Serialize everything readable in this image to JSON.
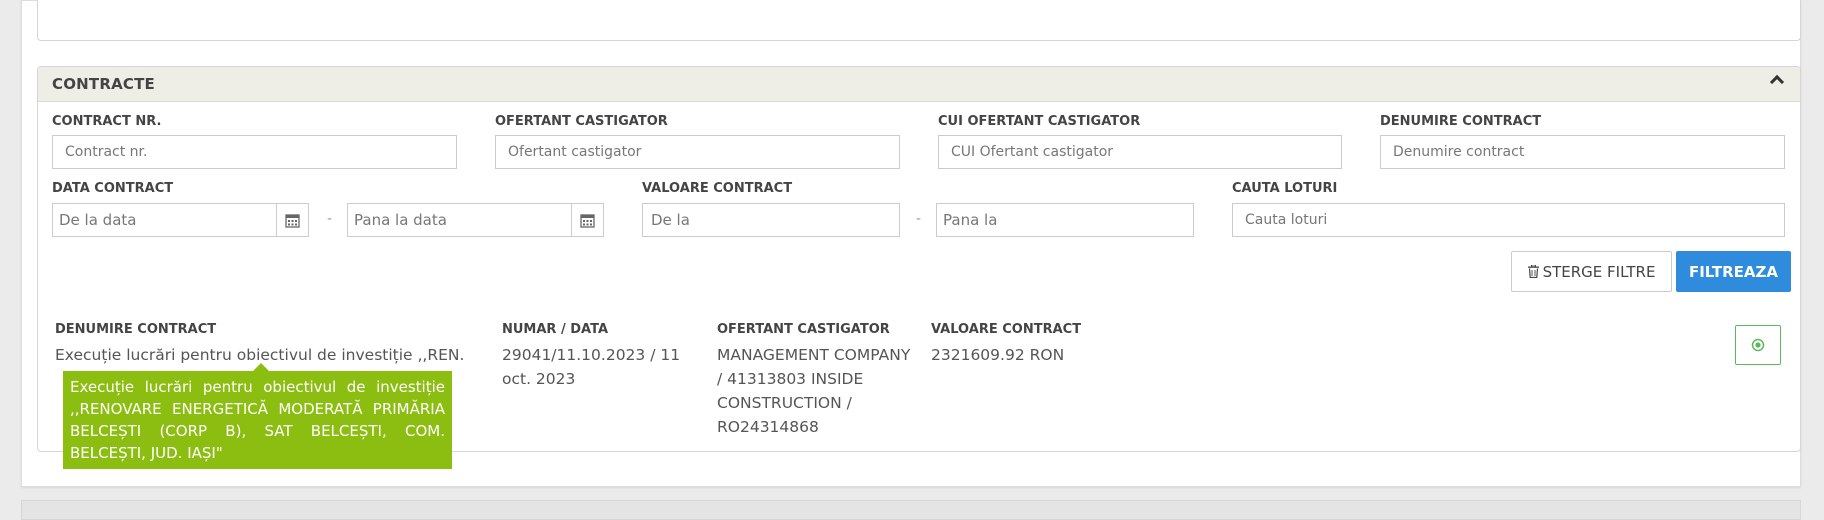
{
  "section": {
    "title": "CONTRACTE"
  },
  "filters": {
    "contract_nr": {
      "label": "CONTRACT NR.",
      "placeholder": "Contract nr."
    },
    "ofertant": {
      "label": "OFERTANT CASTIGATOR",
      "placeholder": "Ofertant castigator"
    },
    "cui": {
      "label": "CUI OFERTANT CASTIGATOR",
      "placeholder": "CUI Ofertant castigator"
    },
    "denumire": {
      "label": "DENUMIRE CONTRACT",
      "placeholder": "Denumire contract"
    },
    "data": {
      "label": "DATA CONTRACT",
      "from_placeholder": "De la data",
      "to_placeholder": "Pana la data",
      "separator": "-"
    },
    "valoare": {
      "label": "VALOARE CONTRACT",
      "from_placeholder": "De la",
      "to_placeholder": "Pana la",
      "separator": "-"
    },
    "loturi": {
      "label": "CAUTA LOTURI",
      "placeholder": "Cauta loturi"
    }
  },
  "buttons": {
    "clear_label": "STERGE FILTRE",
    "filter_label": "FILTREAZA"
  },
  "results": {
    "headers": {
      "denumire": "DENUMIRE CONTRACT",
      "numar_data": "NUMAR / DATA",
      "ofertant": "OFERTANT CASTIGATOR",
      "valoare": "VALOARE CONTRACT"
    },
    "rows": [
      {
        "denumire_short": "Execuție lucrări pentru obiectivul de investiție ,,REN...",
        "numar_data": "29041/11.10.2023 / 11 oct. 2023",
        "ofertant": "MANAGEMENT COMPANY / 41313803 INSIDE CONSTRUCTION / RO24314868",
        "valoare": "2321609.92 RON"
      }
    ]
  },
  "tooltip": {
    "text": "Execuție lucrări pentru obiectivul de investiție ,,RENOVARE ENERGETICĂ MODERATĂ PRIMĂRIA BELCEȘTI (CORP B), SAT BELCEȘTI, COM. BELCEȘTI, JUD. IAȘI\""
  },
  "colors": {
    "primary": "#2f8bdc",
    "tooltip_bg": "#8cbd11",
    "view_icon": "#5cb85c",
    "panel_header_bg": "#eeeee7"
  },
  "icons": {
    "collapse": "chevron-up-icon",
    "calendar": "calendar-icon",
    "trash": "trash-icon",
    "view": "eye-icon"
  }
}
